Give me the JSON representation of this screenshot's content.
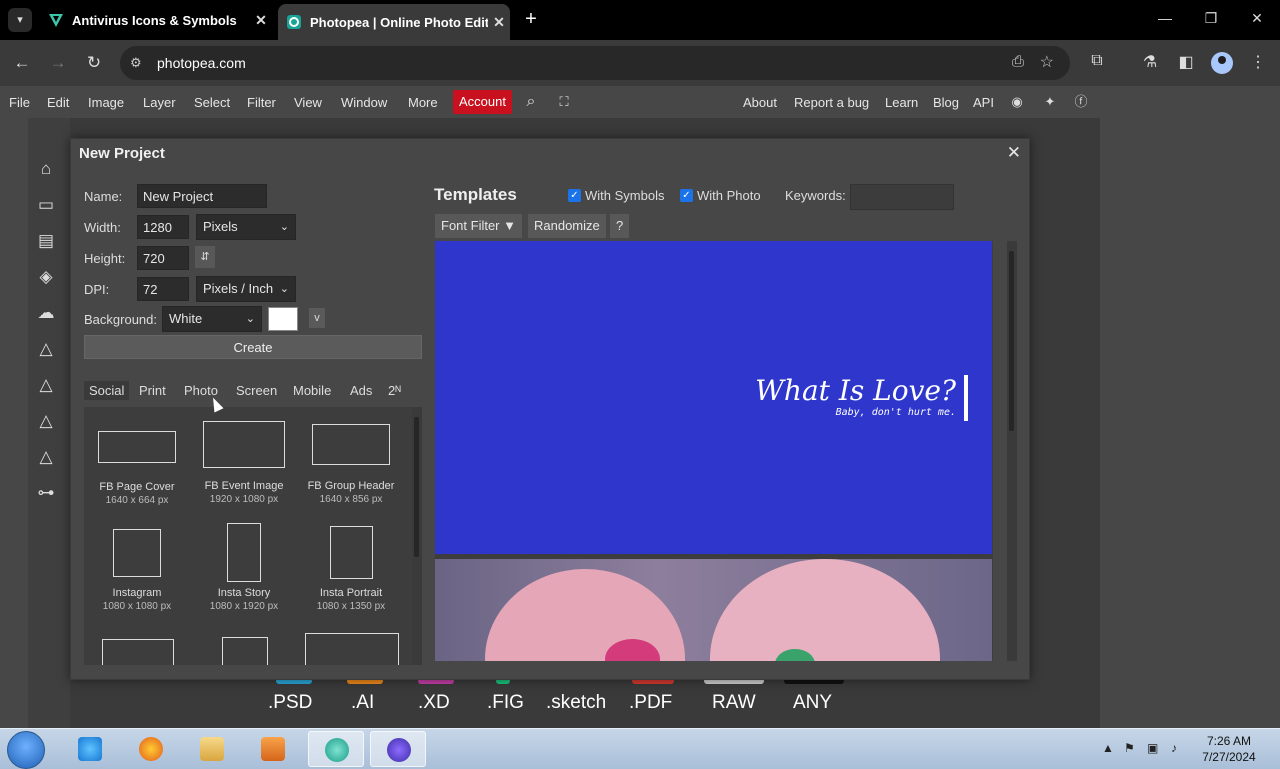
{
  "browser": {
    "tabs": [
      {
        "title": "Antivirus Icons & Symbols",
        "favicon": "triangle-v-icon"
      },
      {
        "title": "Photopea | Online Photo Editor",
        "favicon": "photopea-icon"
      }
    ],
    "url": "photopea.com",
    "window_controls": {
      "min": "—",
      "restore": "❐",
      "close": "✕"
    }
  },
  "menubar": {
    "items": [
      "File",
      "Edit",
      "Image",
      "Layer",
      "Select",
      "Filter",
      "View",
      "Window",
      "More"
    ],
    "account": "Account",
    "right_links": [
      "About",
      "Report a bug",
      "Learn",
      "Blog",
      "API"
    ],
    "accent": "#c8101e"
  },
  "formats": [
    ".PSD",
    ".AI",
    ".XD",
    ".FIG",
    ".sketch",
    ".PDF",
    "RAW",
    "ANY"
  ],
  "dialog": {
    "title": "New Project",
    "name_label": "Name:",
    "name_value": "New Project",
    "width_label": "Width:",
    "width_value": "1280",
    "width_unit": "Pixels",
    "height_label": "Height:",
    "height_value": "720",
    "swap_glyph": "⇵",
    "dpi_label": "DPI:",
    "dpi_value": "72",
    "dpi_unit": "Pixels / Inch",
    "background_label": "Background:",
    "background_value": "White",
    "v_label": "v",
    "create_label": "Create",
    "categories": [
      "Social",
      "Print",
      "Photo",
      "Screen",
      "Mobile",
      "Ads",
      "2ᴺ"
    ],
    "presets": [
      {
        "name": "FB Page Cover",
        "size": "1640 x 664 px"
      },
      {
        "name": "FB Event Image",
        "size": "1920 x 1080 px"
      },
      {
        "name": "FB Group Header",
        "size": "1640 x 856 px"
      },
      {
        "name": "Instagram",
        "size": "1080 x 1080 px"
      },
      {
        "name": "Insta Story",
        "size": "1080 x 1920 px"
      },
      {
        "name": "Insta Portrait",
        "size": "1080 x 1350 px"
      }
    ],
    "templates": {
      "heading": "Templates",
      "with_symbols": "With Symbols",
      "with_photo": "With Photo",
      "keywords_label": "Keywords:",
      "font_filter": "Font Filter ▼",
      "randomize": "Randomize",
      "help": "?",
      "card_title": "What Is Love?",
      "card_subtitle": "Baby, don't hurt me.",
      "card_color": "#2e36cc"
    }
  },
  "taskbar": {
    "time": "7:26 AM",
    "date": "7/27/2024"
  }
}
